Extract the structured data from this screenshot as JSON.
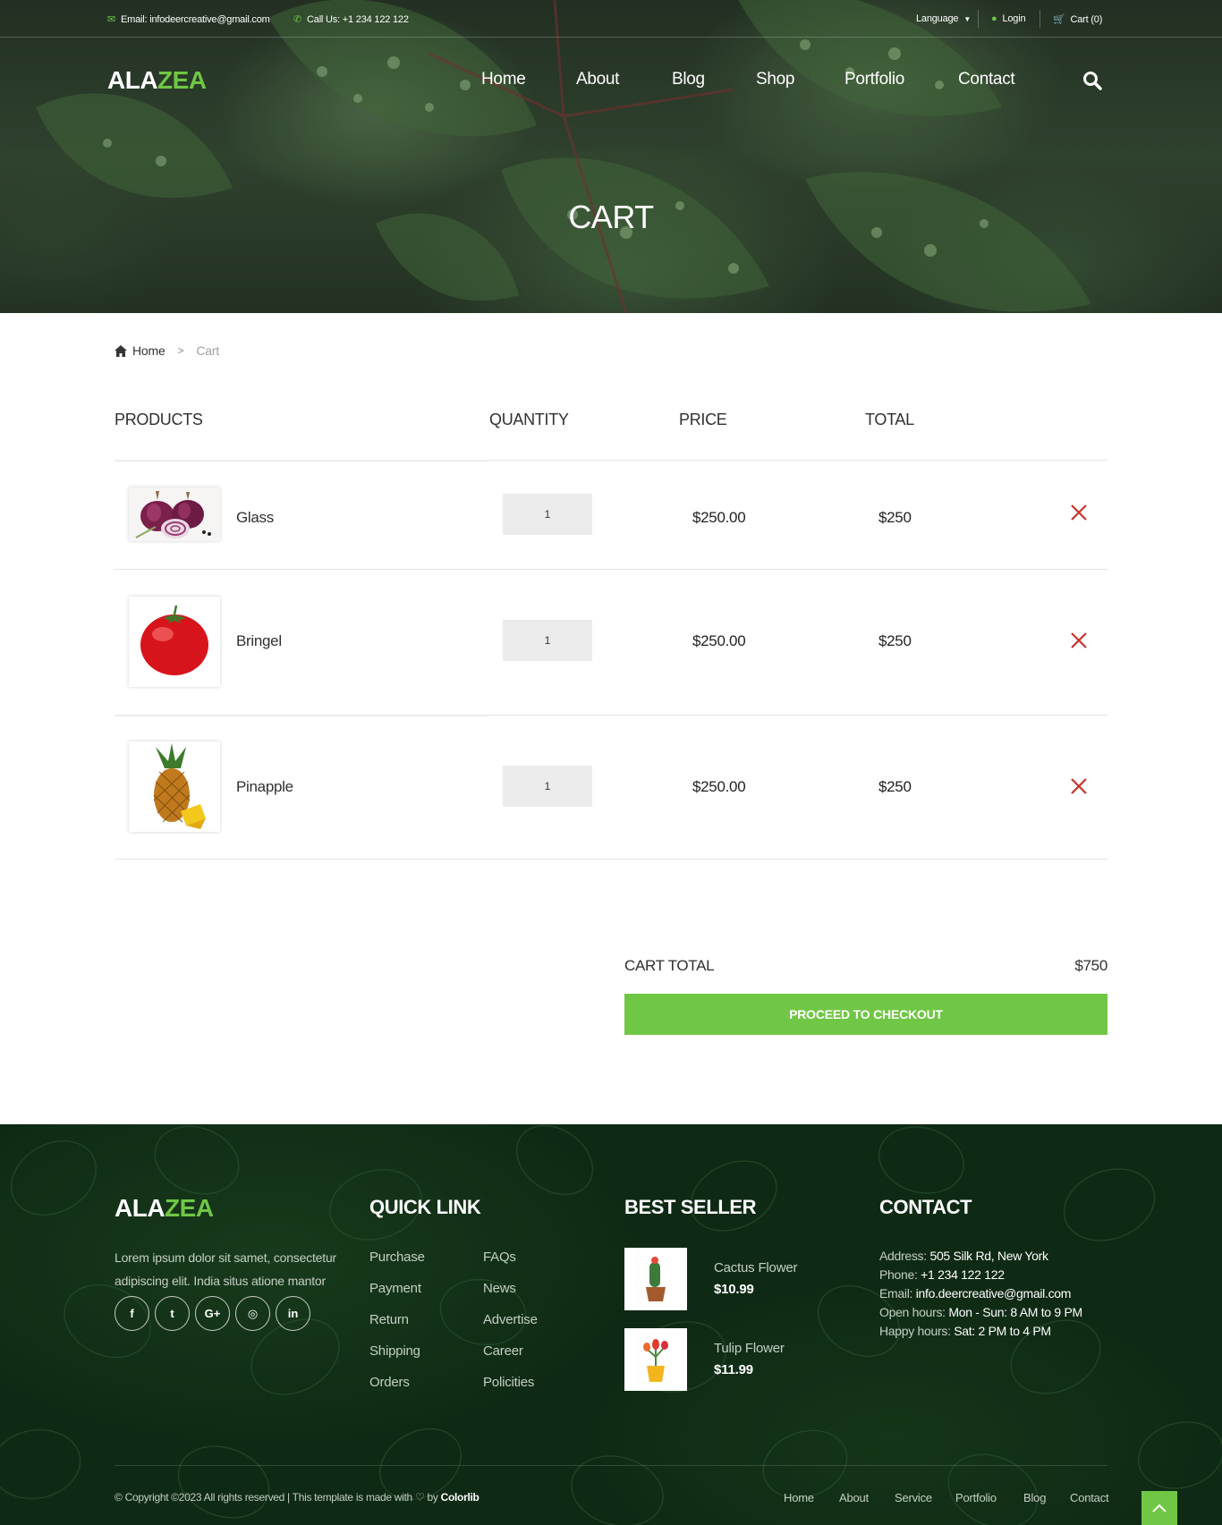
{
  "topbar": {
    "email": "Email: infodeercreative@gmail.com",
    "phone": "Call Us: +1 234 122 122",
    "language": "Language",
    "login": "Login",
    "cart": "Cart (0)"
  },
  "brand": {
    "part1": "ALA",
    "part2": "ZEA"
  },
  "nav": [
    "Home",
    "About",
    "Blog",
    "Shop",
    "Portfolio",
    "Contact"
  ],
  "page_title": "CART",
  "breadcrumb": {
    "home": "Home",
    "separator": ">",
    "current": "Cart"
  },
  "cart": {
    "headers": {
      "products": "PRODUCTS",
      "quantity": "QUANTITY",
      "price": "PRICE",
      "total": "TOTAL"
    },
    "items": [
      {
        "name": "Glass",
        "qty": "1",
        "price": "$250.00",
        "total": "$250",
        "image": "red-onion"
      },
      {
        "name": "Bringel",
        "qty": "1",
        "price": "$250.00",
        "total": "$250",
        "image": "tomato"
      },
      {
        "name": "Pinapple",
        "qty": "1",
        "price": "$250.00",
        "total": "$250",
        "image": "pineapple"
      }
    ],
    "total_label": "CART TOTAL",
    "total_value": "$750",
    "checkout": "PROCEED TO CHECKOUT"
  },
  "footer": {
    "about_text_1": "Lorem ipsum dolor sit samet, consectetur",
    "about_text_2": "adipiscing elit. India situs atione mantor",
    "social": [
      {
        "label": "f",
        "icon": "facebook-icon"
      },
      {
        "label": "t",
        "icon": "twitter-icon"
      },
      {
        "label": "G+",
        "icon": "google-plus-icon"
      },
      {
        "label": "◎",
        "icon": "instagram-icon"
      },
      {
        "label": "in",
        "icon": "linkedin-icon"
      }
    ],
    "quick_link_title": "QUICK LINK",
    "quick_links_col1": [
      "Purchase",
      "Payment",
      "Return",
      "Shipping",
      "Orders"
    ],
    "quick_links_col2": [
      "FAQs",
      "News",
      "Advertise",
      "Career",
      "Policities"
    ],
    "best_seller_title": "BEST SELLER",
    "best_sellers": [
      {
        "name": "Cactus Flower",
        "price": "$10.99"
      },
      {
        "name": "Tulip Flower",
        "price": "$11.99"
      }
    ],
    "contact_title": "CONTACT",
    "contact": [
      {
        "label": "Address:",
        "value": "505 Silk Rd, New York"
      },
      {
        "label": "Phone:",
        "value": "+1 234 122 122"
      },
      {
        "label": "Email:",
        "value": "info.deercreative@gmail.com"
      },
      {
        "label": "Open hours:",
        "value": "Mon - Sun: 8 AM to 9 PM"
      },
      {
        "label": "Happy hours:",
        "value": "Sat: 2 PM to 4 PM"
      }
    ],
    "copyright_text": "© Copyright ©2023 All rights reserved | This template is made with",
    "copyright_by": "by",
    "copyright_brand": "Colorlib",
    "bottom_nav": [
      "Home",
      "About",
      "Service",
      "Portfolio",
      "Blog",
      "Contact"
    ]
  },
  "colors": {
    "accent": "#70c745",
    "remove": "#c8312b",
    "footer_bg": "#0f2a14"
  }
}
